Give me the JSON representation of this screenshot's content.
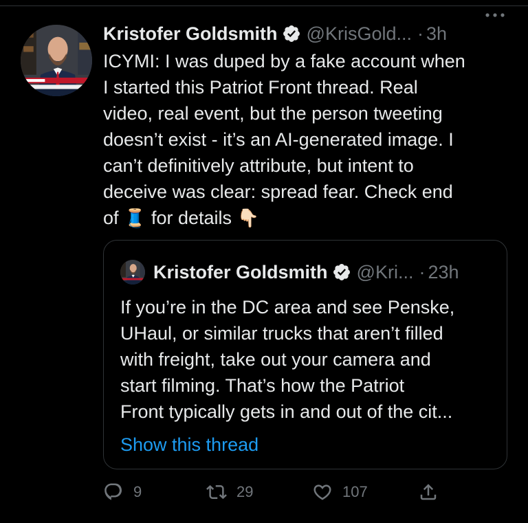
{
  "tweet": {
    "author_name": "Kristofer Goldsmith",
    "handle": "@KrisGold...",
    "dot": "·",
    "time": "3h",
    "more_icon": "more-horizontal-icon",
    "body_lines": [
      "ICYMI: I was duped by a fake account when",
      "I started this Patriot Front thread. Real",
      "video, real event, but the person tweeting",
      "doesn’t exist - it’s an AI-generated image. I",
      "can’t definitively attribute, but intent to",
      "deceive was clear: spread fear. Check end"
    ],
    "body_last_prefix": "of",
    "thread_emoji": "🧵",
    "body_last_suffix": "for details",
    "pointing_emoji": "👇🏻"
  },
  "quote": {
    "author_name": "Kristofer Goldsmith",
    "handle": "@Kri...",
    "dot": "·",
    "time": "23h",
    "text_lines": [
      "If you’re in the DC area and see Penske,",
      "UHaul, or similar trucks that aren’t filled",
      "with freight, take out your camera and",
      "start filming. That’s how the Patriot",
      "Front typically gets in and out of the cit..."
    ],
    "show_thread": "Show this thread"
  },
  "actions": {
    "replies": "9",
    "retweets": "29",
    "likes": "107"
  },
  "colors": {
    "background": "#000000",
    "text": "#e7e9ea",
    "secondary": "#71767b",
    "link": "#1d9bf0",
    "border": "#2f3336"
  }
}
